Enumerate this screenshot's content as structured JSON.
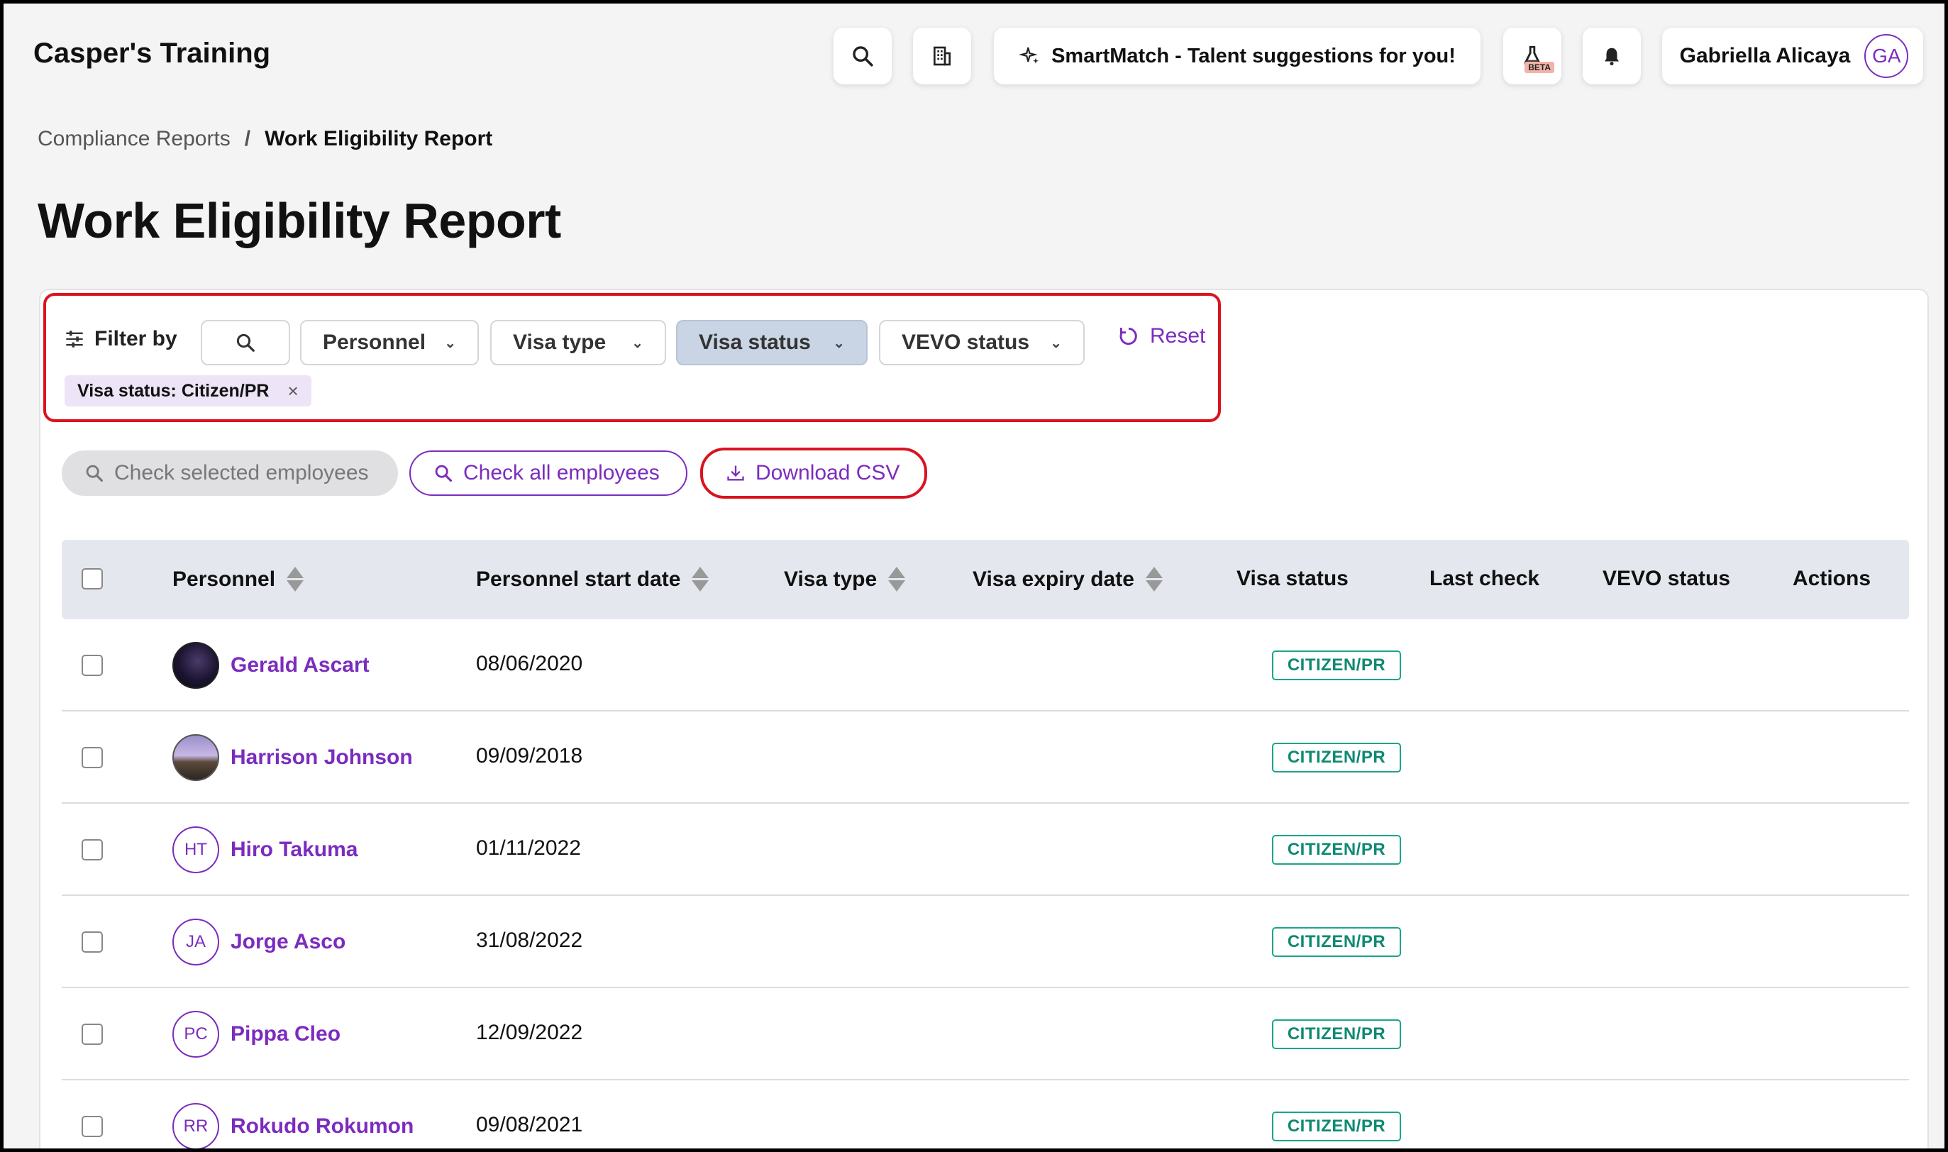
{
  "header": {
    "app_title": "Casper's Training",
    "smartmatch_label": "SmartMatch - Talent suggestions for you!",
    "beta_label": "BETA",
    "user_name": "Gabriella Alicaya",
    "user_initials": "GA"
  },
  "breadcrumb": {
    "parent": "Compliance Reports",
    "separator": "/",
    "current": "Work Eligibility Report"
  },
  "page_title": "Work Eligibility Report",
  "filters": {
    "label": "Filter by",
    "personnel": "Personnel",
    "visa_type": "Visa type",
    "visa_status": "Visa status",
    "vevo_status": "VEVO status",
    "reset": "Reset",
    "active_chip": "Visa status: Citizen/PR",
    "chip_close": "×"
  },
  "actions": {
    "check_selected": "Check selected employees",
    "check_all": "Check all employees",
    "download_csv": "Download CSV"
  },
  "table": {
    "columns": {
      "personnel": "Personnel",
      "start_date": "Personnel start date",
      "visa_type": "Visa type",
      "visa_expiry": "Visa expiry date",
      "visa_status": "Visa status",
      "last_check": "Last check",
      "vevo_status": "VEVO status",
      "actions": "Actions"
    },
    "rows": [
      {
        "name": "Gerald Ascart",
        "initials": "",
        "start_date": "08/06/2020",
        "visa_status": "CITIZEN/PR",
        "avatar": "photo-dark"
      },
      {
        "name": "Harrison Johnson",
        "initials": "",
        "start_date": "09/09/2018",
        "visa_status": "CITIZEN/PR",
        "avatar": "photo-light"
      },
      {
        "name": "Hiro Takuma",
        "initials": "HT",
        "start_date": "01/11/2022",
        "visa_status": "CITIZEN/PR",
        "avatar": "initials"
      },
      {
        "name": "Jorge Asco",
        "initials": "JA",
        "start_date": "31/08/2022",
        "visa_status": "CITIZEN/PR",
        "avatar": "initials"
      },
      {
        "name": "Pippa Cleo",
        "initials": "PC",
        "start_date": "12/09/2022",
        "visa_status": "CITIZEN/PR",
        "avatar": "initials"
      },
      {
        "name": "Rokudo Rokumon",
        "initials": "RR",
        "start_date": "09/08/2021",
        "visa_status": "CITIZEN/PR",
        "avatar": "initials"
      }
    ]
  },
  "colors": {
    "accent": "#7b2cbf",
    "highlight": "#d9141e",
    "badge": "#1aa58a"
  }
}
